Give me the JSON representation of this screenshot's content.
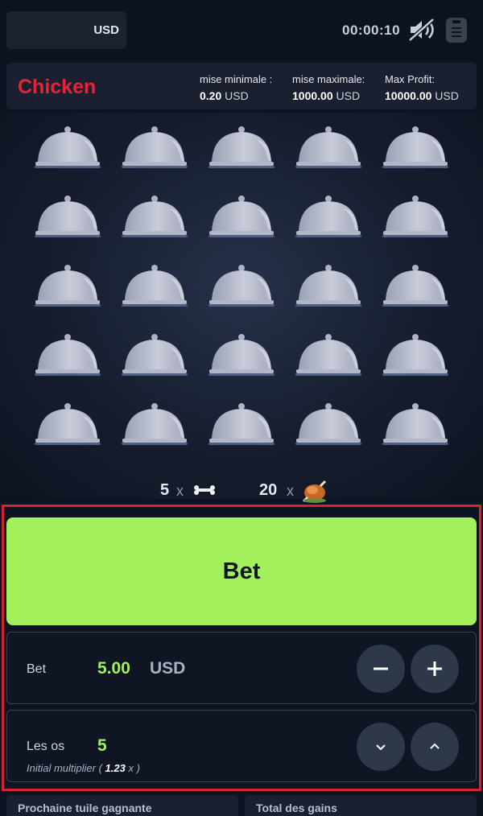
{
  "header": {
    "currency": "USD",
    "timer": "00:00:10",
    "sound_icon": "sound-muted-icon",
    "menu_icon": "clipboard-icon"
  },
  "info": {
    "title": "Chicken",
    "min_label": "mise minimale :",
    "min_value": "0.20",
    "max_label": "mise maximale:",
    "max_value": "1000.00",
    "profit_label": "Max Profit:",
    "profit_value": "10000.00",
    "currency": "USD"
  },
  "board": {
    "rows": 5,
    "cols": 5,
    "tile_icon": "cloche-icon"
  },
  "counts": {
    "bones": "5",
    "chickens": "20",
    "multiply": "x"
  },
  "controls": {
    "bet_button_label": "Bet",
    "bet_label": "Bet",
    "bet_value": "5.00",
    "bet_currency": "USD",
    "bones_label": "Les os",
    "bones_value": "5",
    "multiplier_prefix": "Initial multiplier (",
    "multiplier_value": "1.23",
    "multiplier_suffix": "x )"
  },
  "footer": {
    "next_tile_label": "Prochaine tuile gagnante",
    "total_label": "Total des gains"
  },
  "colors": {
    "accent_green": "#a2f05c",
    "brand_red": "#e5243a",
    "highlight_border": "#d8222d"
  }
}
